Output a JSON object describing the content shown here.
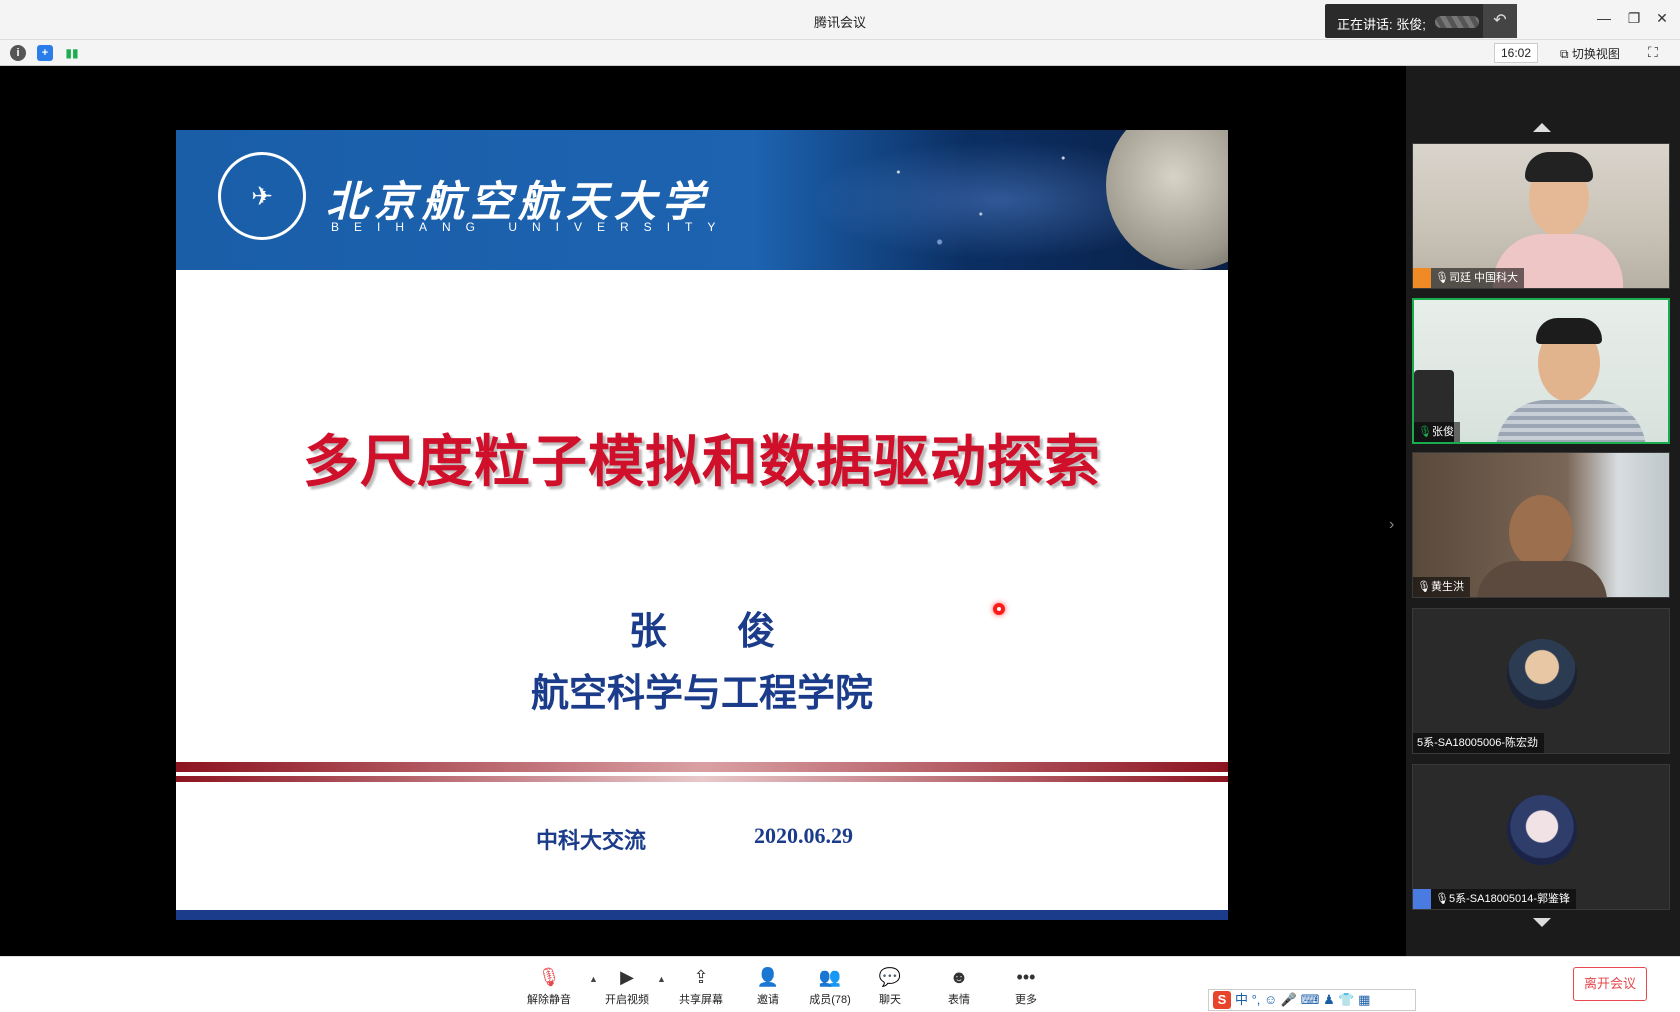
{
  "window": {
    "title": "腾讯会议"
  },
  "speaking": {
    "label": "正在讲话: 张俊;"
  },
  "toolbar_top": {
    "time": "16:02",
    "switch_view": "切换视图"
  },
  "slide": {
    "university_cn": "北京航空航天大学",
    "university_en": "BEIHANG UNIVERSITY",
    "title": "多尺度粒子模拟和数据驱动探索",
    "author": "张 俊",
    "department": "航空科学与工程学院",
    "event": "中科大交流",
    "date": "2020.06.29"
  },
  "participants": [
    {
      "name": "司廷 中国科大"
    },
    {
      "name": "张俊"
    },
    {
      "name": "黄生洪"
    },
    {
      "name": "5系-SA18005006-陈宏劲"
    },
    {
      "name": "5系-SA18005014-郭鉴锋"
    }
  ],
  "bottom_toolbar": {
    "unmute": "解除静音",
    "start_video": "开启视频",
    "share_screen": "共享屏幕",
    "invite": "邀请",
    "members": "成员(78)",
    "chat": "聊天",
    "emoji": "表情",
    "more": "更多",
    "leave": "离开会议"
  },
  "ime": {
    "text": "中 °, ☺ 🎤 ⌨ ♟ 👕 ▦"
  }
}
